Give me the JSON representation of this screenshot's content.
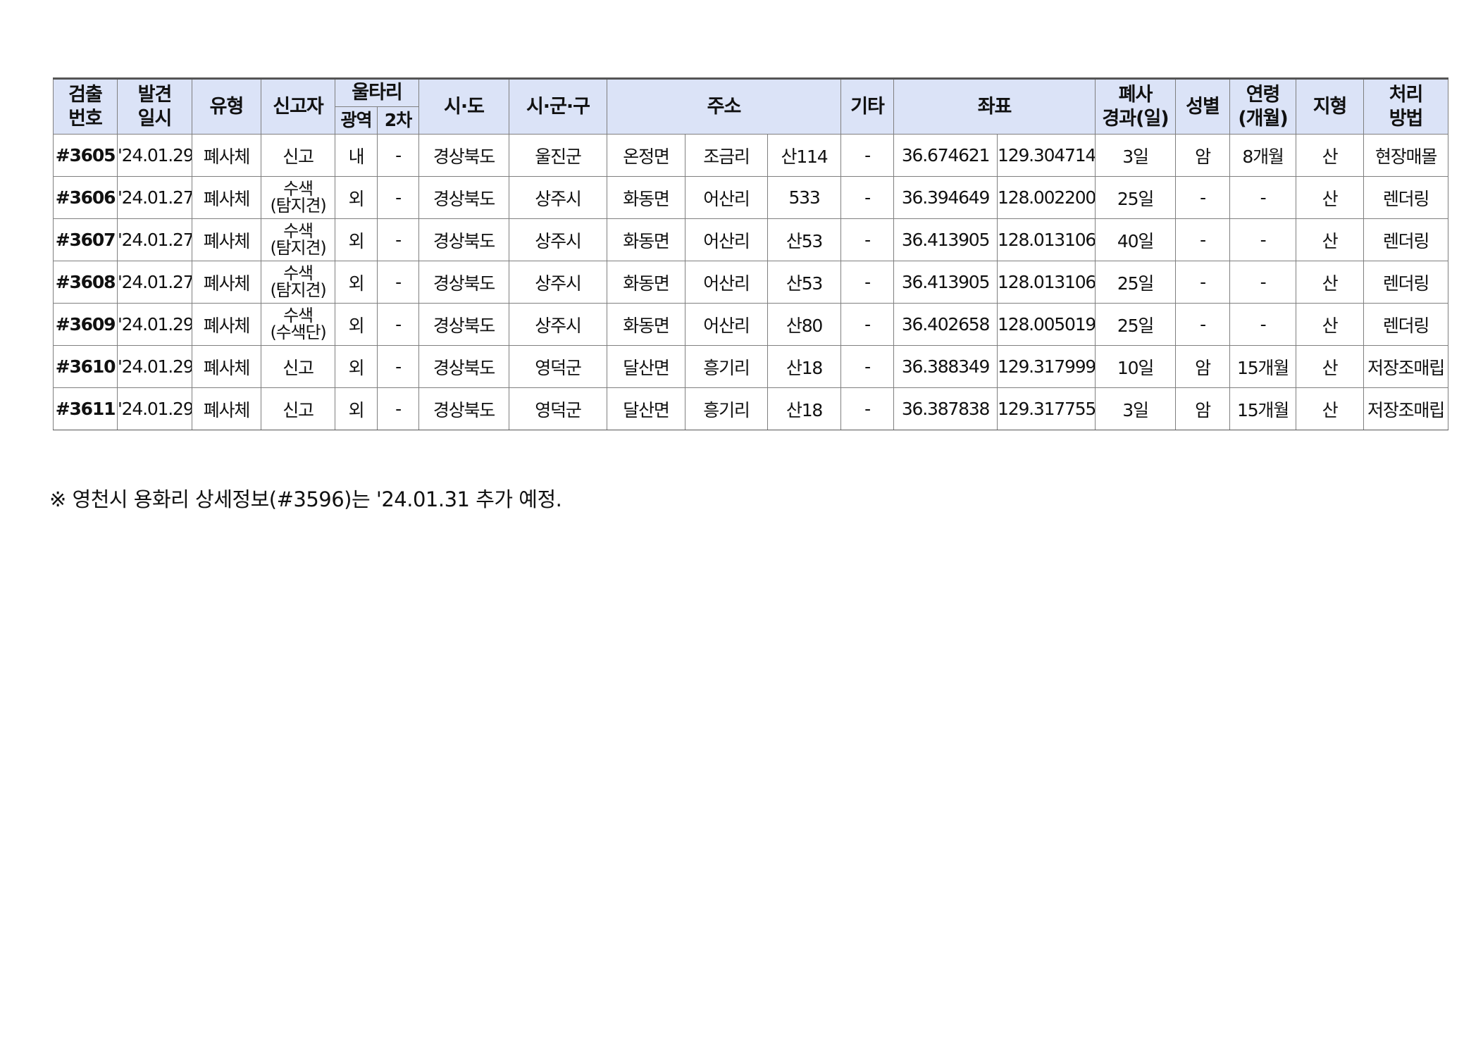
{
  "headers": {
    "id": [
      "검출",
      "번호"
    ],
    "date": [
      "발견",
      "일시"
    ],
    "type": "유형",
    "reporter": "신고자",
    "fence": "울타리",
    "fence_wide": "광역",
    "fence_second": "2차",
    "sido": "시·도",
    "sigungu": "시·군·구",
    "address": "주소",
    "other": "기타",
    "coords": "좌표",
    "decay": [
      "폐사",
      "경과(일)"
    ],
    "sex": "성별",
    "age": [
      "연령",
      "(개월)"
    ],
    "terrain": "지형",
    "disposal": [
      "처리",
      "방법"
    ]
  },
  "rows": [
    {
      "id": "#3605",
      "date": "'24.01.29",
      "type": "폐사체",
      "reporter": [
        "신고"
      ],
      "fence_wide": "내",
      "fence_second": "-",
      "sido": "경상북도",
      "sigungu": "울진군",
      "eup": "온정면",
      "ri": "조금리",
      "lot": "산114",
      "other": "-",
      "lat": "36.674621",
      "lon": "129.304714",
      "decay": "3일",
      "sex": "암",
      "age": "8개월",
      "terrain": "산",
      "disposal": "현장매몰"
    },
    {
      "id": "#3606",
      "date": "'24.01.27",
      "type": "폐사체",
      "reporter": [
        "수색",
        "(탐지견)"
      ],
      "fence_wide": "외",
      "fence_second": "-",
      "sido": "경상북도",
      "sigungu": "상주시",
      "eup": "화동면",
      "ri": "어산리",
      "lot": "533",
      "other": "-",
      "lat": "36.394649",
      "lon": "128.002200",
      "decay": "25일",
      "sex": "-",
      "age": "-",
      "terrain": "산",
      "disposal": "렌더링"
    },
    {
      "id": "#3607",
      "date": "'24.01.27",
      "type": "폐사체",
      "reporter": [
        "수색",
        "(탐지견)"
      ],
      "fence_wide": "외",
      "fence_second": "-",
      "sido": "경상북도",
      "sigungu": "상주시",
      "eup": "화동면",
      "ri": "어산리",
      "lot": "산53",
      "other": "-",
      "lat": "36.413905",
      "lon": "128.013106",
      "decay": "40일",
      "sex": "-",
      "age": "-",
      "terrain": "산",
      "disposal": "렌더링"
    },
    {
      "id": "#3608",
      "date": "'24.01.27",
      "type": "폐사체",
      "reporter": [
        "수색",
        "(탐지견)"
      ],
      "fence_wide": "외",
      "fence_second": "-",
      "sido": "경상북도",
      "sigungu": "상주시",
      "eup": "화동면",
      "ri": "어산리",
      "lot": "산53",
      "other": "-",
      "lat": "36.413905",
      "lon": "128.013106",
      "decay": "25일",
      "sex": "-",
      "age": "-",
      "terrain": "산",
      "disposal": "렌더링"
    },
    {
      "id": "#3609",
      "date": "'24.01.29",
      "type": "폐사체",
      "reporter": [
        "수색",
        "(수색단)"
      ],
      "fence_wide": "외",
      "fence_second": "-",
      "sido": "경상북도",
      "sigungu": "상주시",
      "eup": "화동면",
      "ri": "어산리",
      "lot": "산80",
      "other": "-",
      "lat": "36.402658",
      "lon": "128.005019",
      "decay": "25일",
      "sex": "-",
      "age": "-",
      "terrain": "산",
      "disposal": "렌더링"
    },
    {
      "id": "#3610",
      "date": "'24.01.29",
      "type": "폐사체",
      "reporter": [
        "신고"
      ],
      "fence_wide": "외",
      "fence_second": "-",
      "sido": "경상북도",
      "sigungu": "영덕군",
      "eup": "달산면",
      "ri": "흥기리",
      "lot": "산18",
      "other": "-",
      "lat": "36.388349",
      "lon": "129.317999",
      "decay": "10일",
      "sex": "암",
      "age": "15개월",
      "terrain": "산",
      "disposal": "저장조매립"
    },
    {
      "id": "#3611",
      "date": "'24.01.29",
      "type": "폐사체",
      "reporter": [
        "신고"
      ],
      "fence_wide": "외",
      "fence_second": "-",
      "sido": "경상북도",
      "sigungu": "영덕군",
      "eup": "달산면",
      "ri": "흥기리",
      "lot": "산18",
      "other": "-",
      "lat": "36.387838",
      "lon": "129.317755",
      "decay": "3일",
      "sex": "암",
      "age": "15개월",
      "terrain": "산",
      "disposal": "저장조매립"
    }
  ],
  "note": "※ 영천시 용화리 상세정보(#3596)는 '24.01.31 추가 예정."
}
